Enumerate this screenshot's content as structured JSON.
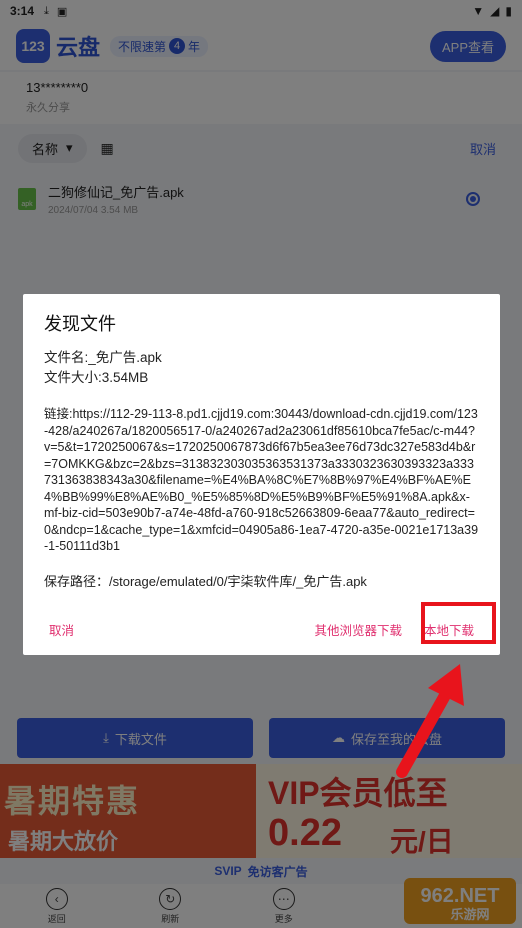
{
  "status_bar": {
    "time": "3:14",
    "icons": [
      "download-icon",
      "notification-a-icon",
      "wifi-icon",
      "signal-icon",
      "battery-icon"
    ]
  },
  "header": {
    "logo_mark": "123",
    "logo_text": "云盘",
    "tagline_prefix": "不限速第",
    "tagline_num": "4",
    "tagline_suffix": "年",
    "app_button": "APP查看"
  },
  "share": {
    "user": "13********0",
    "permission": "永久分享"
  },
  "toolbar": {
    "sort_label": "名称",
    "cancel": "取消"
  },
  "file": {
    "name": "二狗修仙记_免广告.apk",
    "meta": "2024/07/04 3.54 MB",
    "icon_label": "apk"
  },
  "actions": {
    "download": "下载文件",
    "save": "保存至我的云盘"
  },
  "banner": {
    "left_title": "暑期特惠",
    "left_sub": "暑期大放价",
    "right_title": "VIP会员低至",
    "right_price": "0.22",
    "right_unit": "元/日"
  },
  "svip_bar": {
    "brand": "SVIP",
    "text": "免访客广告"
  },
  "bottom_nav": [
    {
      "label": "返回",
      "icon": "back-icon"
    },
    {
      "label": "刷新",
      "icon": "refresh-icon"
    },
    {
      "label": "更多",
      "icon": "more-icon"
    }
  ],
  "watermark": {
    "top": "962.NET",
    "bottom": "乐游网"
  },
  "dialog": {
    "title": "发现文件",
    "file_name": "文件名:_免广告.apk",
    "file_size": "文件大小:3.54MB",
    "link": "链接:https://112-29-113-8.pd1.cjjd19.com:30443/download-cdn.cjjd19.com/123-428/a240267a/1820056517-0/a240267ad2a23061df85610bca7fe5ac/c-m44?v=5&t=1720250067&s=1720250067873d6f67b5ea3ee76d73dc327e583d4b&r=7OMKKG&bzc=2&bzs=313832303035363531373a3330323630393323a333731363838343a30&filename=%E4%BA%8C%E7%8B%97%E4%BF%AE%E4%BB%99%E8%AE%B0_%E5%85%8D%E5%B9%BF%E5%91%8A.apk&x-mf-biz-cid=503e90b7-a74e-48fd-a760-918c52663809-6eaa77&auto_redirect=0&ndcp=1&cache_type=1&xmfcid=04905a86-1ea7-4720-a35e-0021e1713a39-1-50111d3b1",
    "save_path": "保存路径：/storage/emulated/0/宇柒软件库/_免广告.apk",
    "cancel": "取消",
    "other_browser": "其他浏览器下载",
    "local_download": "本地下载"
  },
  "colors": {
    "accent": "#3b5fe0",
    "dialog_button": "#e0306f",
    "highlight": "#e8141c"
  }
}
